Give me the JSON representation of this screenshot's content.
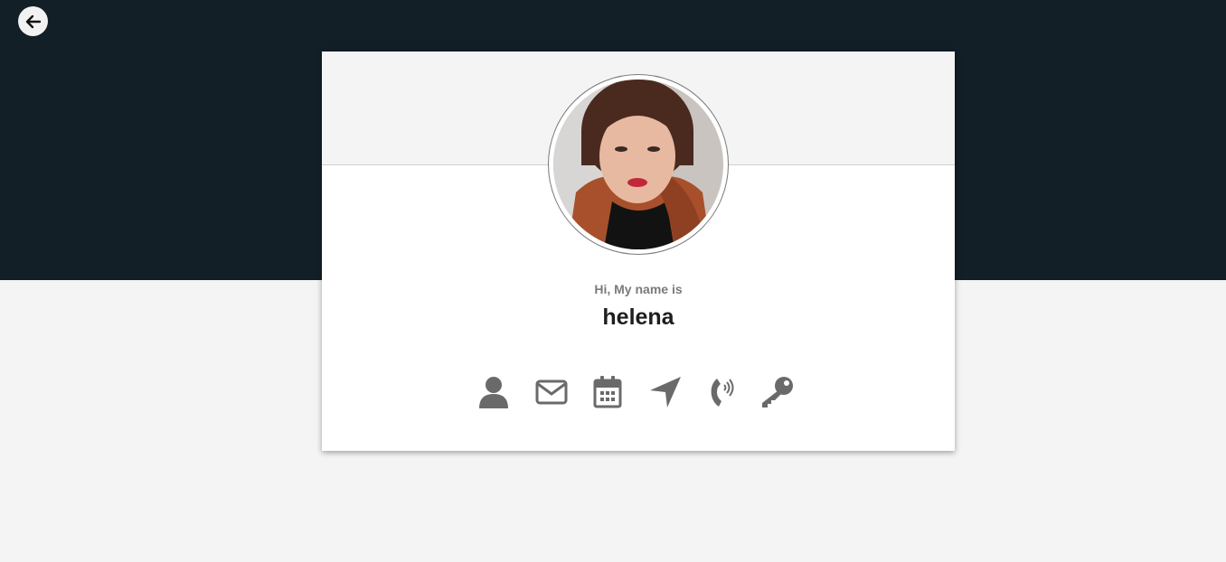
{
  "header": {
    "back_icon": "arrow-left-icon"
  },
  "profile": {
    "greeting": "Hi, My name is",
    "name": "helena",
    "avatar": "profile-photo"
  },
  "icons": [
    {
      "name": "user-icon"
    },
    {
      "name": "envelope-icon"
    },
    {
      "name": "calendar-icon"
    },
    {
      "name": "location-arrow-icon"
    },
    {
      "name": "phone-volume-icon"
    },
    {
      "name": "key-icon"
    }
  ],
  "colors": {
    "top_band": "#121f26",
    "page_bg": "#f4f4f4",
    "icon": "#6a6a6a",
    "greeting_text": "#7b7b7b",
    "name_text": "#1e1e1e"
  }
}
